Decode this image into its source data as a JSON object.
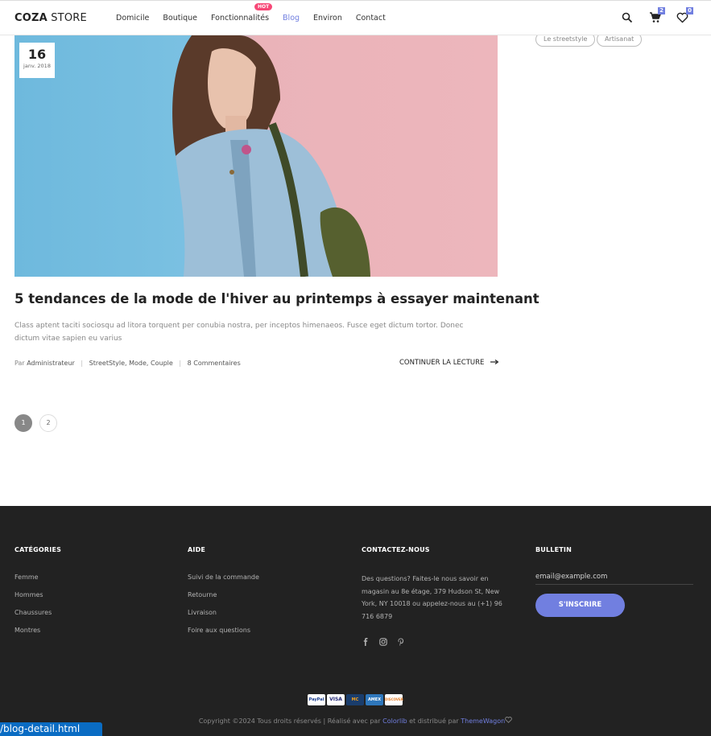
{
  "header": {
    "logo_bold": "COZA",
    "logo_rest": "STORE",
    "nav": [
      "Domicile",
      "Boutique",
      "Fonctionnalités",
      "Blog",
      "Environ",
      "Contact"
    ],
    "hot_badge": "HOT",
    "cart_count": "2",
    "wishlist_count": "0"
  },
  "tags": [
    "Le streetstyle",
    "Artisanat"
  ],
  "post": {
    "day": "16",
    "month": "janv. 2018",
    "title": "5 tendances de la mode de l'hiver au printemps à essayer maintenant",
    "excerpt": "Class aptent taciti sociosqu ad litora torquent per conubia nostra, per inceptos himenaeos. Fusce eget dictum tortor. Donec dictum vitae sapien eu varius",
    "meta_by": "Par",
    "meta_author": "Administrateur",
    "meta_categories": "StreetStyle, Mode, Couple",
    "meta_comments": "8 Commentaires",
    "read_more": "CONTINUER LA LECTURE"
  },
  "pagination": [
    "1",
    "2"
  ],
  "footer": {
    "categories": {
      "title": "CATÉGORIES",
      "items": [
        "Femme",
        "Hommes",
        "Chaussures",
        "Montres"
      ]
    },
    "help": {
      "title": "AIDE",
      "items": [
        "Suivi de la commande",
        "Retourne",
        "Livraison",
        "Foire aux questions"
      ]
    },
    "contact": {
      "title": "CONTACTEZ-NOUS",
      "text": "Des questions? Faites-le nous savoir en magasin au 8e étage, 379 Hudson St, New York, NY 10018 ou appelez-nous au (+1) 96 716 6879"
    },
    "newsletter": {
      "title": "BULLETIN",
      "placeholder": "email@example.com",
      "button": "S'INSCRIRE"
    },
    "payments": [
      "PayPal",
      "VISA",
      "MC",
      "AMEX",
      "DISCOVER"
    ],
    "copyright_pre": "Copyright ©2024 Tous droits réservés | Réalisé avec par ",
    "copyright_link1": "Colorlib",
    "copyright_mid": " et distribué par ",
    "copyright_link2": "ThemeWagon"
  },
  "statusbar": "/blog-detail.html",
  "colors": {
    "accent": "#717fe0",
    "hot": "#f74877",
    "footer_bg": "#222222"
  }
}
